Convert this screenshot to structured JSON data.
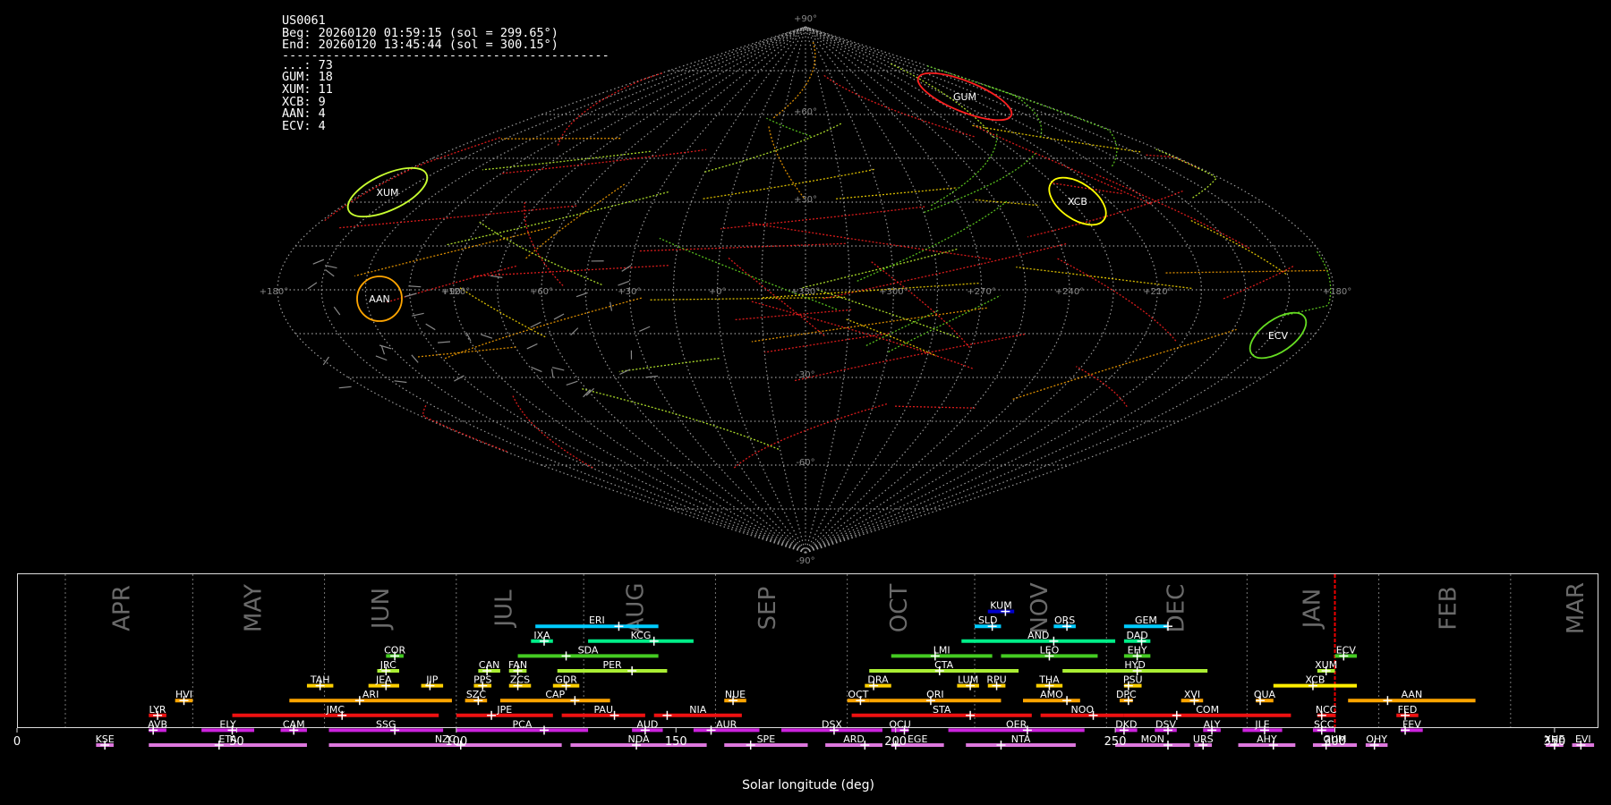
{
  "info": {
    "station": "US0061",
    "beg": "Beg: 20260120 01:59:15 (sol = 299.65°)",
    "end": "End: 20260120 13:45:44 (sol = 300.15°)",
    "divider": "---------------------------------------------",
    "counts": [
      "...: 73",
      "GUM: 18",
      "XUM: 11",
      "XCB: 9",
      "AAN: 4",
      "ECV: 4"
    ]
  },
  "sky_map": {
    "projection": "sinusoidal",
    "lat_labels": [
      "+90°",
      "+60°",
      "+30°",
      "-30°",
      "-60°",
      "-90°"
    ],
    "lon_labels": [
      "+180°",
      "+120°",
      "+90°",
      "+60°",
      "+30°",
      "+0°",
      "+330°",
      "+300°",
      "+270°",
      "+240°",
      "+210°",
      "+180°"
    ],
    "radiants": [
      {
        "code": "GUM",
        "color": "#ff2020"
      },
      {
        "code": "XUM",
        "color": "#c8ff30"
      },
      {
        "code": "XCB",
        "color": "#ffff00"
      },
      {
        "code": "AAN",
        "color": "#ffa500"
      },
      {
        "code": "ECV",
        "color": "#66dd22"
      }
    ]
  },
  "chart_data": {
    "type": "timeline",
    "xlabel": "Solar longitude (deg)",
    "xlim": [
      0,
      360
    ],
    "xticks": [
      "0",
      "50",
      "100",
      "150",
      "200",
      "250",
      "300",
      "350"
    ],
    "months": [
      {
        "label": "APR",
        "sl": 24
      },
      {
        "label": "MAY",
        "sl": 54
      },
      {
        "label": "JUN",
        "sl": 83
      },
      {
        "label": "JUL",
        "sl": 111
      },
      {
        "label": "AUG",
        "sl": 141
      },
      {
        "label": "SEP",
        "sl": 171
      },
      {
        "label": "OCT",
        "sl": 201
      },
      {
        "label": "NOV",
        "sl": 233
      },
      {
        "label": "DEC",
        "sl": 264
      },
      {
        "label": "JAN",
        "sl": 295
      },
      {
        "label": "FEB",
        "sl": 326
      },
      {
        "label": "MAR",
        "sl": 355
      }
    ],
    "month_boundaries": [
      11,
      40,
      70,
      100,
      129,
      159,
      189,
      218,
      248,
      280,
      310,
      340
    ],
    "current_sl": 300,
    "showers": [
      {
        "code": "KUM",
        "start": 221,
        "end": 227,
        "peak": 225,
        "row": 9,
        "color": "#0000cc"
      },
      {
        "code": "ERI",
        "start": 118,
        "end": 146,
        "peak": 137,
        "row": 8,
        "color": "#00ccff"
      },
      {
        "code": "SLD",
        "start": 218,
        "end": 224,
        "peak": 222,
        "row": 8,
        "color": "#00ccff"
      },
      {
        "code": "ORS",
        "start": 236,
        "end": 241,
        "peak": 239,
        "row": 8,
        "color": "#00ccff"
      },
      {
        "code": "GEM",
        "start": 252,
        "end": 262,
        "peak": 262,
        "row": 8,
        "color": "#00ccff"
      },
      {
        "code": "IXA",
        "start": 117,
        "end": 122,
        "peak": 120,
        "row": 7,
        "color": "#00ee88"
      },
      {
        "code": "KCG",
        "start": 130,
        "end": 154,
        "peak": 145,
        "row": 7,
        "color": "#00ee88"
      },
      {
        "code": "AND",
        "start": 215,
        "end": 250,
        "peak": 236,
        "row": 7,
        "color": "#00ee88"
      },
      {
        "code": "DAD",
        "start": 252,
        "end": 258,
        "peak": 256,
        "row": 7,
        "color": "#00ee88"
      },
      {
        "code": "COR",
        "start": 84,
        "end": 88,
        "peak": 86,
        "row": 6,
        "color": "#44cc22"
      },
      {
        "code": "SDA",
        "start": 114,
        "end": 146,
        "peak": 125,
        "row": 6,
        "color": "#44cc22"
      },
      {
        "code": "LMI",
        "start": 199,
        "end": 222,
        "peak": 209,
        "row": 6,
        "color": "#44cc22"
      },
      {
        "code": "LEO",
        "start": 224,
        "end": 246,
        "peak": 235,
        "row": 6,
        "color": "#44cc22"
      },
      {
        "code": "EHY",
        "start": 252,
        "end": 258,
        "peak": 255,
        "row": 6,
        "color": "#44cc22"
      },
      {
        "code": "ECV",
        "start": 300,
        "end": 305,
        "peak": 302,
        "row": 6,
        "color": "#44cc22"
      },
      {
        "code": "JRC",
        "start": 82,
        "end": 87,
        "peak": 84,
        "row": 5,
        "color": "#aaee33"
      },
      {
        "code": "CAN",
        "start": 105,
        "end": 110,
        "peak": 107,
        "row": 5,
        "color": "#aaee33"
      },
      {
        "code": "FAN",
        "start": 112,
        "end": 116,
        "peak": 114,
        "row": 5,
        "color": "#aaee33"
      },
      {
        "code": "PER",
        "start": 123,
        "end": 148,
        "peak": 140,
        "row": 5,
        "color": "#aaee33"
      },
      {
        "code": "CTA",
        "start": 194,
        "end": 228,
        "peak": 210,
        "row": 5,
        "color": "#aaee33"
      },
      {
        "code": "HYD",
        "start": 238,
        "end": 271,
        "peak": 255,
        "row": 5,
        "color": "#aaee33"
      },
      {
        "code": "XUM",
        "start": 296,
        "end": 300,
        "peak": 298,
        "row": 5,
        "color": "#aaee33"
      },
      {
        "code": "TAH",
        "start": 66,
        "end": 72,
        "peak": 69,
        "row": 4,
        "color": "#ffd000"
      },
      {
        "code": "JEA",
        "start": 80,
        "end": 87,
        "peak": 84,
        "row": 4,
        "color": "#ffd000"
      },
      {
        "code": "JIP",
        "start": 92,
        "end": 97,
        "peak": 94,
        "row": 4,
        "color": "#ffd000"
      },
      {
        "code": "PPS",
        "start": 104,
        "end": 108,
        "peak": 106,
        "row": 4,
        "color": "#ffd000"
      },
      {
        "code": "ZCS",
        "start": 112,
        "end": 117,
        "peak": 114,
        "row": 4,
        "color": "#ffd000"
      },
      {
        "code": "GDR",
        "start": 122,
        "end": 128,
        "peak": 125,
        "row": 4,
        "color": "#ffd000"
      },
      {
        "code": "DRA",
        "start": 193,
        "end": 199,
        "peak": 195,
        "row": 4,
        "color": "#ffd000"
      },
      {
        "code": "LUM",
        "start": 214,
        "end": 219,
        "peak": 217,
        "row": 4,
        "color": "#ffd000"
      },
      {
        "code": "RPU",
        "start": 221,
        "end": 225,
        "peak": 223,
        "row": 4,
        "color": "#ffd000"
      },
      {
        "code": "THA",
        "start": 232,
        "end": 238,
        "peak": 235,
        "row": 4,
        "color": "#ffd000"
      },
      {
        "code": "PSU",
        "start": 252,
        "end": 256,
        "peak": 253,
        "row": 4,
        "color": "#ffd000"
      },
      {
        "code": "XCB",
        "start": 286,
        "end": 305,
        "peak": 295,
        "row": 4,
        "color": "#ffee00"
      },
      {
        "code": "HVI",
        "start": 36,
        "end": 40,
        "peak": 38,
        "row": 3,
        "color": "#ffa500"
      },
      {
        "code": "ARI",
        "start": 62,
        "end": 99,
        "peak": 78,
        "row": 3,
        "color": "#ffa500"
      },
      {
        "code": "SZC",
        "start": 102,
        "end": 107,
        "peak": 105,
        "row": 3,
        "color": "#ffa500"
      },
      {
        "code": "CAP",
        "start": 110,
        "end": 135,
        "peak": 127,
        "row": 3,
        "color": "#ffa500"
      },
      {
        "code": "NUE",
        "start": 161,
        "end": 166,
        "peak": 163,
        "row": 3,
        "color": "#ffa500"
      },
      {
        "code": "OCT",
        "start": 189,
        "end": 194,
        "peak": 192,
        "row": 3,
        "color": "#ffa500"
      },
      {
        "code": "ORI",
        "start": 194,
        "end": 224,
        "peak": 208,
        "row": 3,
        "color": "#ffa500"
      },
      {
        "code": "AMO",
        "start": 229,
        "end": 242,
        "peak": 239,
        "row": 3,
        "color": "#ffa500"
      },
      {
        "code": "DPC",
        "start": 251,
        "end": 254,
        "peak": 253,
        "row": 3,
        "color": "#ffa500"
      },
      {
        "code": "XVI",
        "start": 265,
        "end": 270,
        "peak": 268,
        "row": 3,
        "color": "#ffa500"
      },
      {
        "code": "QUA",
        "start": 282,
        "end": 286,
        "peak": 283,
        "row": 3,
        "color": "#ffa500"
      },
      {
        "code": "AAN",
        "start": 303,
        "end": 332,
        "peak": 312,
        "row": 3,
        "color": "#ffa500"
      },
      {
        "code": "LYR",
        "start": 30,
        "end": 34,
        "peak": 32,
        "row": 2,
        "color": "#ee1111"
      },
      {
        "code": "JMC",
        "start": 49,
        "end": 96,
        "peak": 74,
        "row": 2,
        "color": "#ee1111"
      },
      {
        "code": "JPE",
        "start": 100,
        "end": 122,
        "peak": 108,
        "row": 2,
        "color": "#ee1111"
      },
      {
        "code": "PAU",
        "start": 124,
        "end": 143,
        "peak": 136,
        "row": 2,
        "color": "#ee1111"
      },
      {
        "code": "NIA",
        "start": 145,
        "end": 165,
        "peak": 148,
        "row": 2,
        "color": "#ee1111"
      },
      {
        "code": "STA",
        "start": 190,
        "end": 231,
        "peak": 217,
        "row": 2,
        "color": "#ee1111"
      },
      {
        "code": "NOO",
        "start": 233,
        "end": 252,
        "peak": 245,
        "row": 2,
        "color": "#ee1111"
      },
      {
        "code": "COM",
        "start": 252,
        "end": 290,
        "peak": 264,
        "row": 2,
        "color": "#ee1111"
      },
      {
        "code": "NCC",
        "start": 296,
        "end": 300,
        "peak": 297,
        "row": 2,
        "color": "#ee1111"
      },
      {
        "code": "FED",
        "start": 314,
        "end": 319,
        "peak": 316,
        "row": 2,
        "color": "#ee1111"
      },
      {
        "code": "AVB",
        "start": 30,
        "end": 34,
        "peak": 31,
        "row": 1,
        "color": "#cc22dd"
      },
      {
        "code": "ELY",
        "start": 42,
        "end": 54,
        "peak": 49,
        "row": 1,
        "color": "#cc22dd"
      },
      {
        "code": "CAM",
        "start": 60,
        "end": 66,
        "peak": 63,
        "row": 1,
        "color": "#cc22dd"
      },
      {
        "code": "SSG",
        "start": 71,
        "end": 97,
        "peak": 86,
        "row": 1,
        "color": "#cc22dd"
      },
      {
        "code": "PCA",
        "start": 100,
        "end": 130,
        "peak": 120,
        "row": 1,
        "color": "#cc22dd"
      },
      {
        "code": "AUD",
        "start": 140,
        "end": 147,
        "peak": 143,
        "row": 1,
        "color": "#cc22dd"
      },
      {
        "code": "AUR",
        "start": 154,
        "end": 169,
        "peak": 158,
        "row": 1,
        "color": "#cc22dd"
      },
      {
        "code": "DSX",
        "start": 174,
        "end": 197,
        "peak": 186,
        "row": 1,
        "color": "#cc22dd"
      },
      {
        "code": "OCU",
        "start": 199,
        "end": 203,
        "peak": 202,
        "row": 1,
        "color": "#cc22dd"
      },
      {
        "code": "OER",
        "start": 212,
        "end": 243,
        "peak": 230,
        "row": 1,
        "color": "#cc22dd"
      },
      {
        "code": "DKD",
        "start": 250,
        "end": 255,
        "peak": 252,
        "row": 1,
        "color": "#cc22dd"
      },
      {
        "code": "DSV",
        "start": 259,
        "end": 264,
        "peak": 262,
        "row": 1,
        "color": "#cc22dd"
      },
      {
        "code": "ALY",
        "start": 270,
        "end": 274,
        "peak": 272,
        "row": 1,
        "color": "#cc22dd"
      },
      {
        "code": "JLE",
        "start": 279,
        "end": 288,
        "peak": 284,
        "row": 1,
        "color": "#cc22dd"
      },
      {
        "code": "SCC",
        "start": 295,
        "end": 300,
        "peak": 297,
        "row": 1,
        "color": "#cc22dd"
      },
      {
        "code": "FEV",
        "start": 315,
        "end": 320,
        "peak": 316,
        "row": 1,
        "color": "#cc22dd"
      },
      {
        "code": "KSE",
        "start": 18,
        "end": 22,
        "peak": 20,
        "row": 0,
        "color": "#dd77dd"
      },
      {
        "code": "ETA",
        "start": 30,
        "end": 66,
        "peak": 46,
        "row": 0,
        "color": "#dd77dd"
      },
      {
        "code": "NZC",
        "start": 71,
        "end": 124,
        "peak": 101,
        "row": 0,
        "color": "#dd77dd"
      },
      {
        "code": "NDA",
        "start": 126,
        "end": 157,
        "peak": 141,
        "row": 0,
        "color": "#dd77dd"
      },
      {
        "code": "SPE",
        "start": 161,
        "end": 180,
        "peak": 167,
        "row": 0,
        "color": "#dd77dd"
      },
      {
        "code": "ARD",
        "start": 184,
        "end": 197,
        "peak": 193,
        "row": 0,
        "color": "#dd77dd"
      },
      {
        "code": "EGE",
        "start": 199,
        "end": 211,
        "peak": 200,
        "row": 0,
        "color": "#dd77dd"
      },
      {
        "code": "NTA",
        "start": 216,
        "end": 241,
        "peak": 224,
        "row": 0,
        "color": "#dd77dd"
      },
      {
        "code": "MON",
        "start": 250,
        "end": 267,
        "peak": 262,
        "row": 0,
        "color": "#dd77dd"
      },
      {
        "code": "URS",
        "start": 268,
        "end": 272,
        "peak": 270,
        "row": 0,
        "color": "#dd77dd"
      },
      {
        "code": "AHY",
        "start": 278,
        "end": 291,
        "peak": 286,
        "row": 0,
        "color": "#dd77dd"
      },
      {
        "code": "GUM",
        "start": 295,
        "end": 305,
        "peak": 298,
        "row": 0,
        "color": "#dd77dd"
      },
      {
        "code": "OHY",
        "start": 307,
        "end": 312,
        "peak": 309,
        "row": 0,
        "color": "#dd77dd"
      },
      {
        "code": "XHE",
        "start": 348,
        "end": 352,
        "peak": 350,
        "row": 0,
        "color": "#dd77dd"
      },
      {
        "code": "EVI",
        "start": 354,
        "end": 359,
        "peak": 356,
        "row": 0,
        "color": "#dd77dd"
      }
    ]
  }
}
